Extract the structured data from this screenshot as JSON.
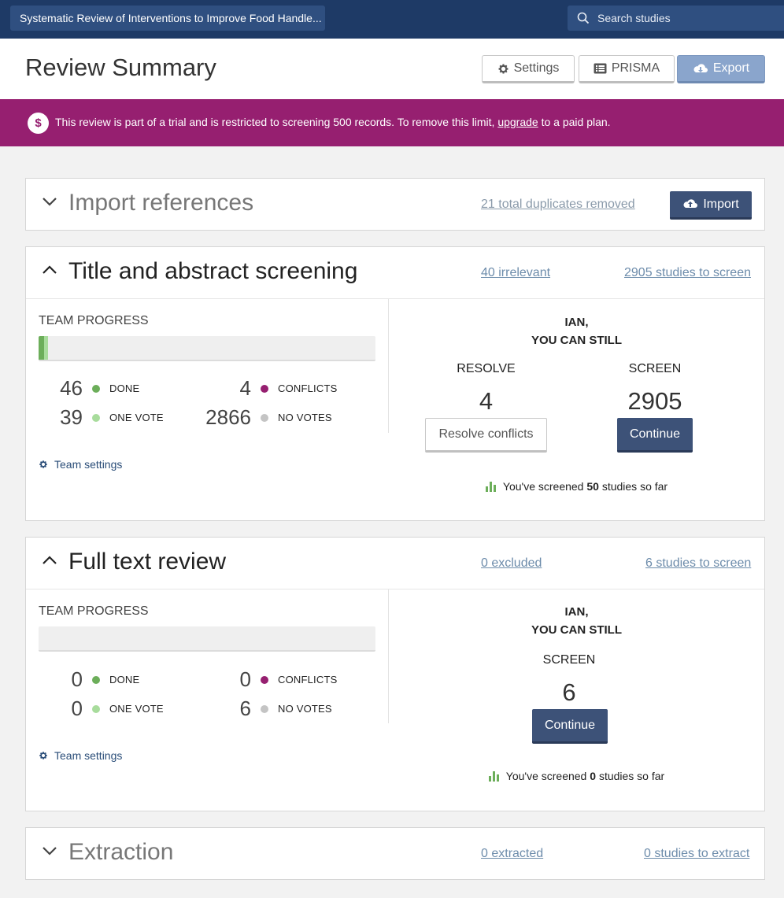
{
  "topbar": {
    "review_title": "Systematic Review of Interventions to Improve Food Handle...",
    "search_placeholder": "Search studies"
  },
  "header": {
    "title": "Review Summary",
    "settings_label": "Settings",
    "prisma_label": "PRISMA",
    "export_label": "Export"
  },
  "banner": {
    "text_before": "This review is part of a trial and is restricted to screening 500 records. To remove this limit,",
    "link": "upgrade",
    "text_after": "to a paid plan."
  },
  "import": {
    "title": "Import references",
    "duplicates_link": "21 total duplicates removed",
    "button_label": "Import"
  },
  "title_abstract": {
    "title": "Title and abstract screening",
    "irrelevant_link": "40 irrelevant",
    "to_screen_link": "2905 studies to screen",
    "team_progress_label": "TEAM PROGRESS",
    "progress": {
      "done_fraction": 0.0158,
      "one_vote_fraction": 0.0134
    },
    "stats": {
      "done": "46",
      "done_label": "DONE",
      "conflicts": "4",
      "conflicts_label": "CONFLICTS",
      "one_vote": "39",
      "one_vote_label": "ONE VOTE",
      "no_votes": "2866",
      "no_votes_label": "NO VOTES"
    },
    "team_settings": "Team settings",
    "you_line1": "IAN,",
    "you_line2": "YOU CAN STILL",
    "resolve_label": "RESOLVE",
    "resolve_count": "4",
    "resolve_button": "Resolve conflicts",
    "screen_label": "SCREEN",
    "screen_count": "2905",
    "continue_button": "Continue",
    "screened_prefix": "You've screened",
    "screened_count": "50",
    "screened_suffix": "studies so far"
  },
  "full_text": {
    "title": "Full text review",
    "excluded_link": "0 excluded",
    "to_screen_link": "6 studies to screen",
    "team_progress_label": "TEAM PROGRESS",
    "progress": {
      "done_fraction": 0,
      "one_vote_fraction": 0
    },
    "stats": {
      "done": "0",
      "done_label": "DONE",
      "conflicts": "0",
      "conflicts_label": "CONFLICTS",
      "one_vote": "0",
      "one_vote_label": "ONE VOTE",
      "no_votes": "6",
      "no_votes_label": "NO VOTES"
    },
    "team_settings": "Team settings",
    "you_line1": "IAN,",
    "you_line2": "YOU CAN STILL",
    "screen_label": "SCREEN",
    "screen_count": "6",
    "continue_button": "Continue",
    "screened_prefix": "You've screened",
    "screened_count": "0",
    "screened_suffix": "studies so far"
  },
  "extraction": {
    "title": "Extraction",
    "extracted_link": "0 extracted",
    "to_extract_link": "0 studies to extract"
  },
  "colors": {
    "topbar": "#1e3a66",
    "banner": "#961f70",
    "done": "#6cae5a",
    "one_vote": "#a8dc9c",
    "conflicts": "#961f70",
    "no_votes": "#c4c4c4",
    "primary_button": "#3d5278"
  },
  "icons": [
    "search-icon",
    "gear-icon",
    "list-icon",
    "cloud-download-icon",
    "dollar-icon",
    "chevron-down-icon",
    "chevron-up-icon",
    "cloud-upload-icon",
    "bar-chart-icon"
  ]
}
